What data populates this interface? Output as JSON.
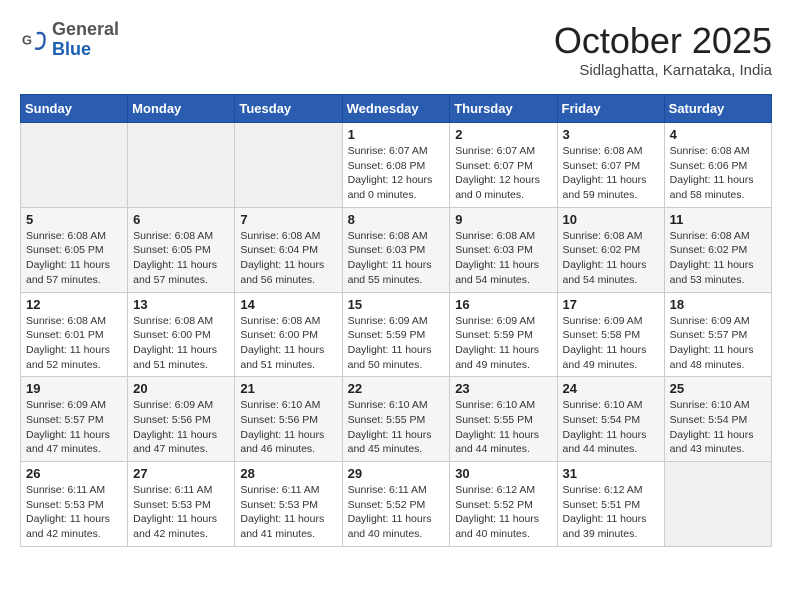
{
  "logo": {
    "general": "General",
    "blue": "Blue"
  },
  "header": {
    "month": "October 2025",
    "location": "Sidlaghatta, Karnataka, India"
  },
  "weekdays": [
    "Sunday",
    "Monday",
    "Tuesday",
    "Wednesday",
    "Thursday",
    "Friday",
    "Saturday"
  ],
  "weeks": [
    [
      {
        "day": "",
        "sunrise": "",
        "sunset": "",
        "daylight": ""
      },
      {
        "day": "",
        "sunrise": "",
        "sunset": "",
        "daylight": ""
      },
      {
        "day": "",
        "sunrise": "",
        "sunset": "",
        "daylight": ""
      },
      {
        "day": "1",
        "sunrise": "Sunrise: 6:07 AM",
        "sunset": "Sunset: 6:08 PM",
        "daylight": "Daylight: 12 hours and 0 minutes."
      },
      {
        "day": "2",
        "sunrise": "Sunrise: 6:07 AM",
        "sunset": "Sunset: 6:07 PM",
        "daylight": "Daylight: 12 hours and 0 minutes."
      },
      {
        "day": "3",
        "sunrise": "Sunrise: 6:08 AM",
        "sunset": "Sunset: 6:07 PM",
        "daylight": "Daylight: 11 hours and 59 minutes."
      },
      {
        "day": "4",
        "sunrise": "Sunrise: 6:08 AM",
        "sunset": "Sunset: 6:06 PM",
        "daylight": "Daylight: 11 hours and 58 minutes."
      }
    ],
    [
      {
        "day": "5",
        "sunrise": "Sunrise: 6:08 AM",
        "sunset": "Sunset: 6:05 PM",
        "daylight": "Daylight: 11 hours and 57 minutes."
      },
      {
        "day": "6",
        "sunrise": "Sunrise: 6:08 AM",
        "sunset": "Sunset: 6:05 PM",
        "daylight": "Daylight: 11 hours and 57 minutes."
      },
      {
        "day": "7",
        "sunrise": "Sunrise: 6:08 AM",
        "sunset": "Sunset: 6:04 PM",
        "daylight": "Daylight: 11 hours and 56 minutes."
      },
      {
        "day": "8",
        "sunrise": "Sunrise: 6:08 AM",
        "sunset": "Sunset: 6:03 PM",
        "daylight": "Daylight: 11 hours and 55 minutes."
      },
      {
        "day": "9",
        "sunrise": "Sunrise: 6:08 AM",
        "sunset": "Sunset: 6:03 PM",
        "daylight": "Daylight: 11 hours and 54 minutes."
      },
      {
        "day": "10",
        "sunrise": "Sunrise: 6:08 AM",
        "sunset": "Sunset: 6:02 PM",
        "daylight": "Daylight: 11 hours and 54 minutes."
      },
      {
        "day": "11",
        "sunrise": "Sunrise: 6:08 AM",
        "sunset": "Sunset: 6:02 PM",
        "daylight": "Daylight: 11 hours and 53 minutes."
      }
    ],
    [
      {
        "day": "12",
        "sunrise": "Sunrise: 6:08 AM",
        "sunset": "Sunset: 6:01 PM",
        "daylight": "Daylight: 11 hours and 52 minutes."
      },
      {
        "day": "13",
        "sunrise": "Sunrise: 6:08 AM",
        "sunset": "Sunset: 6:00 PM",
        "daylight": "Daylight: 11 hours and 51 minutes."
      },
      {
        "day": "14",
        "sunrise": "Sunrise: 6:08 AM",
        "sunset": "Sunset: 6:00 PM",
        "daylight": "Daylight: 11 hours and 51 minutes."
      },
      {
        "day": "15",
        "sunrise": "Sunrise: 6:09 AM",
        "sunset": "Sunset: 5:59 PM",
        "daylight": "Daylight: 11 hours and 50 minutes."
      },
      {
        "day": "16",
        "sunrise": "Sunrise: 6:09 AM",
        "sunset": "Sunset: 5:59 PM",
        "daylight": "Daylight: 11 hours and 49 minutes."
      },
      {
        "day": "17",
        "sunrise": "Sunrise: 6:09 AM",
        "sunset": "Sunset: 5:58 PM",
        "daylight": "Daylight: 11 hours and 49 minutes."
      },
      {
        "day": "18",
        "sunrise": "Sunrise: 6:09 AM",
        "sunset": "Sunset: 5:57 PM",
        "daylight": "Daylight: 11 hours and 48 minutes."
      }
    ],
    [
      {
        "day": "19",
        "sunrise": "Sunrise: 6:09 AM",
        "sunset": "Sunset: 5:57 PM",
        "daylight": "Daylight: 11 hours and 47 minutes."
      },
      {
        "day": "20",
        "sunrise": "Sunrise: 6:09 AM",
        "sunset": "Sunset: 5:56 PM",
        "daylight": "Daylight: 11 hours and 47 minutes."
      },
      {
        "day": "21",
        "sunrise": "Sunrise: 6:10 AM",
        "sunset": "Sunset: 5:56 PM",
        "daylight": "Daylight: 11 hours and 46 minutes."
      },
      {
        "day": "22",
        "sunrise": "Sunrise: 6:10 AM",
        "sunset": "Sunset: 5:55 PM",
        "daylight": "Daylight: 11 hours and 45 minutes."
      },
      {
        "day": "23",
        "sunrise": "Sunrise: 6:10 AM",
        "sunset": "Sunset: 5:55 PM",
        "daylight": "Daylight: 11 hours and 44 minutes."
      },
      {
        "day": "24",
        "sunrise": "Sunrise: 6:10 AM",
        "sunset": "Sunset: 5:54 PM",
        "daylight": "Daylight: 11 hours and 44 minutes."
      },
      {
        "day": "25",
        "sunrise": "Sunrise: 6:10 AM",
        "sunset": "Sunset: 5:54 PM",
        "daylight": "Daylight: 11 hours and 43 minutes."
      }
    ],
    [
      {
        "day": "26",
        "sunrise": "Sunrise: 6:11 AM",
        "sunset": "Sunset: 5:53 PM",
        "daylight": "Daylight: 11 hours and 42 minutes."
      },
      {
        "day": "27",
        "sunrise": "Sunrise: 6:11 AM",
        "sunset": "Sunset: 5:53 PM",
        "daylight": "Daylight: 11 hours and 42 minutes."
      },
      {
        "day": "28",
        "sunrise": "Sunrise: 6:11 AM",
        "sunset": "Sunset: 5:53 PM",
        "daylight": "Daylight: 11 hours and 41 minutes."
      },
      {
        "day": "29",
        "sunrise": "Sunrise: 6:11 AM",
        "sunset": "Sunset: 5:52 PM",
        "daylight": "Daylight: 11 hours and 40 minutes."
      },
      {
        "day": "30",
        "sunrise": "Sunrise: 6:12 AM",
        "sunset": "Sunset: 5:52 PM",
        "daylight": "Daylight: 11 hours and 40 minutes."
      },
      {
        "day": "31",
        "sunrise": "Sunrise: 6:12 AM",
        "sunset": "Sunset: 5:51 PM",
        "daylight": "Daylight: 11 hours and 39 minutes."
      },
      {
        "day": "",
        "sunrise": "",
        "sunset": "",
        "daylight": ""
      }
    ]
  ]
}
